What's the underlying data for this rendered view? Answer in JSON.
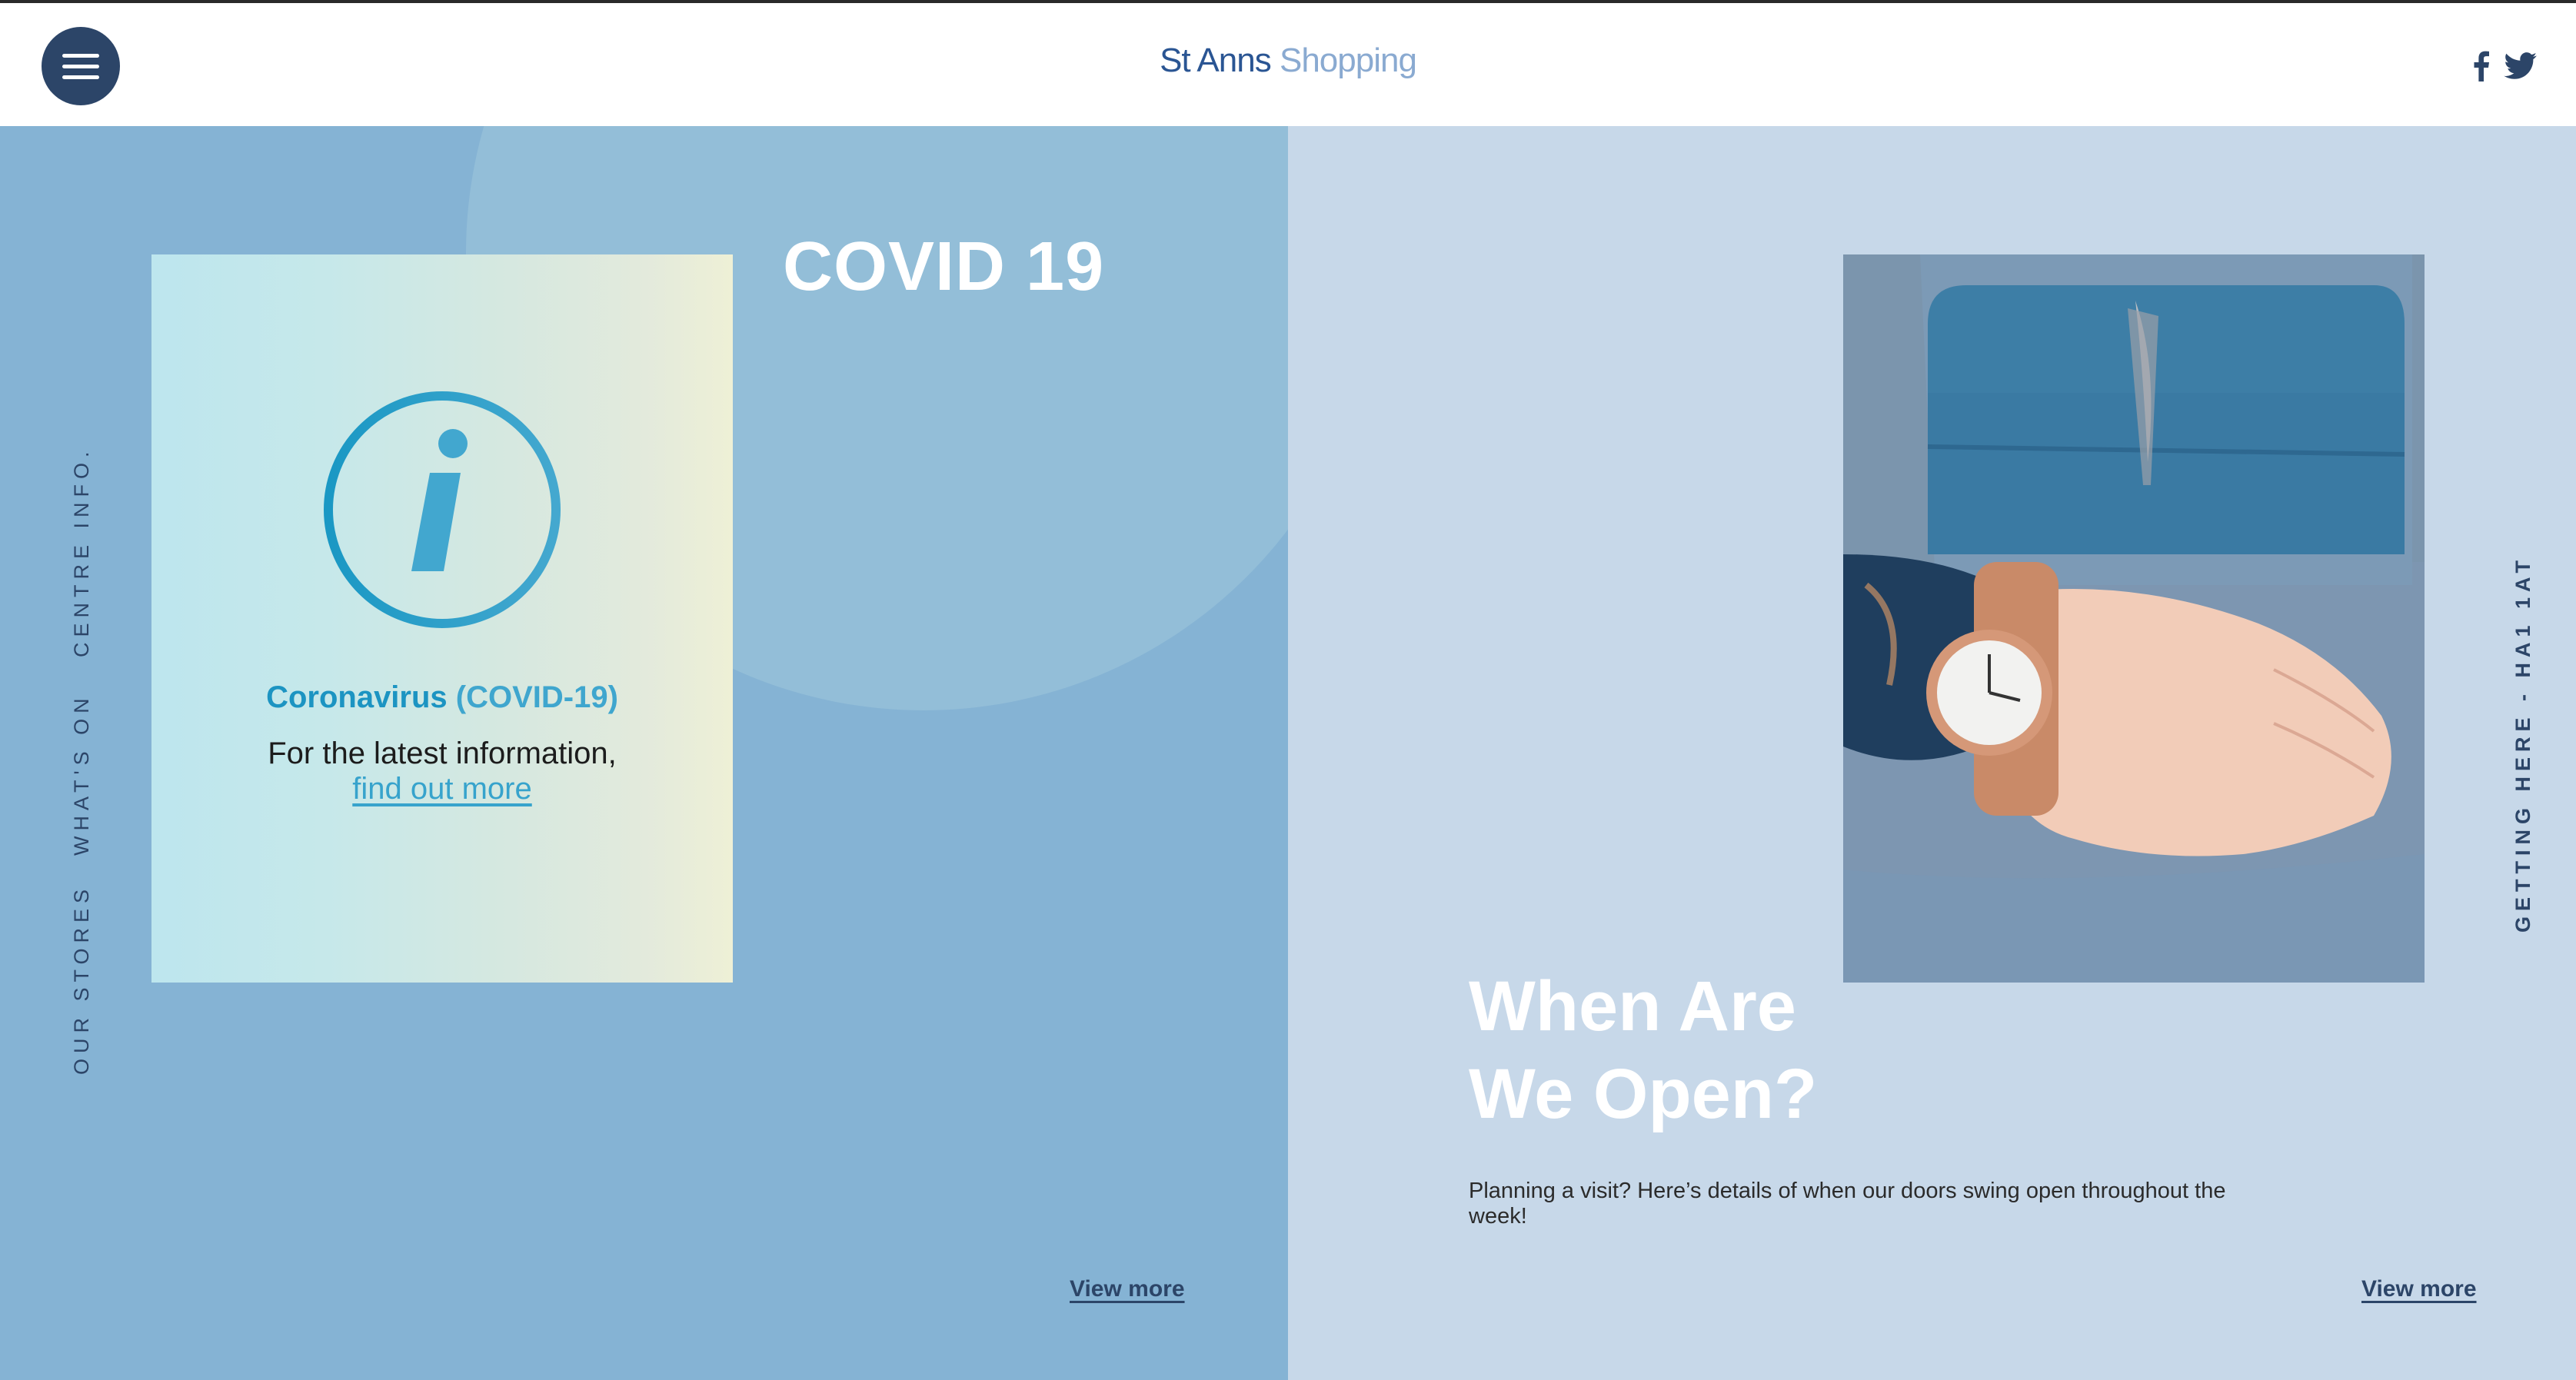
{
  "header": {
    "logo_part1": "St Anns",
    "logo_part2": "Shopping",
    "menu_icon": "hamburger-icon",
    "social": [
      "facebook-icon",
      "twitter-icon"
    ]
  },
  "side_nav": {
    "left_items": [
      "CENTRE INFO.",
      "WHAT'S ON",
      "OUR STORES"
    ],
    "right_item": "GETTING HERE - HA1 1AT"
  },
  "covid_section": {
    "heading": "COVID 19",
    "card": {
      "icon": "info-icon",
      "title_part1": "Coronavirus",
      "title_part2": "(COVID-19)",
      "text": "For the latest information,",
      "link": "find out more"
    },
    "view_more": "View more"
  },
  "open_section": {
    "heading_line1": "When Are",
    "heading_line2": "We Open?",
    "text": "Planning a visit? Here’s details of when our doors swing open throughout the week!",
    "view_more": "View more",
    "image": "watch-and-bag-photo"
  },
  "colors": {
    "navy": "#2c4568",
    "left_panel": "#85b3d4",
    "right_panel": "#c7d8e9",
    "accent": "#1c94c2"
  }
}
